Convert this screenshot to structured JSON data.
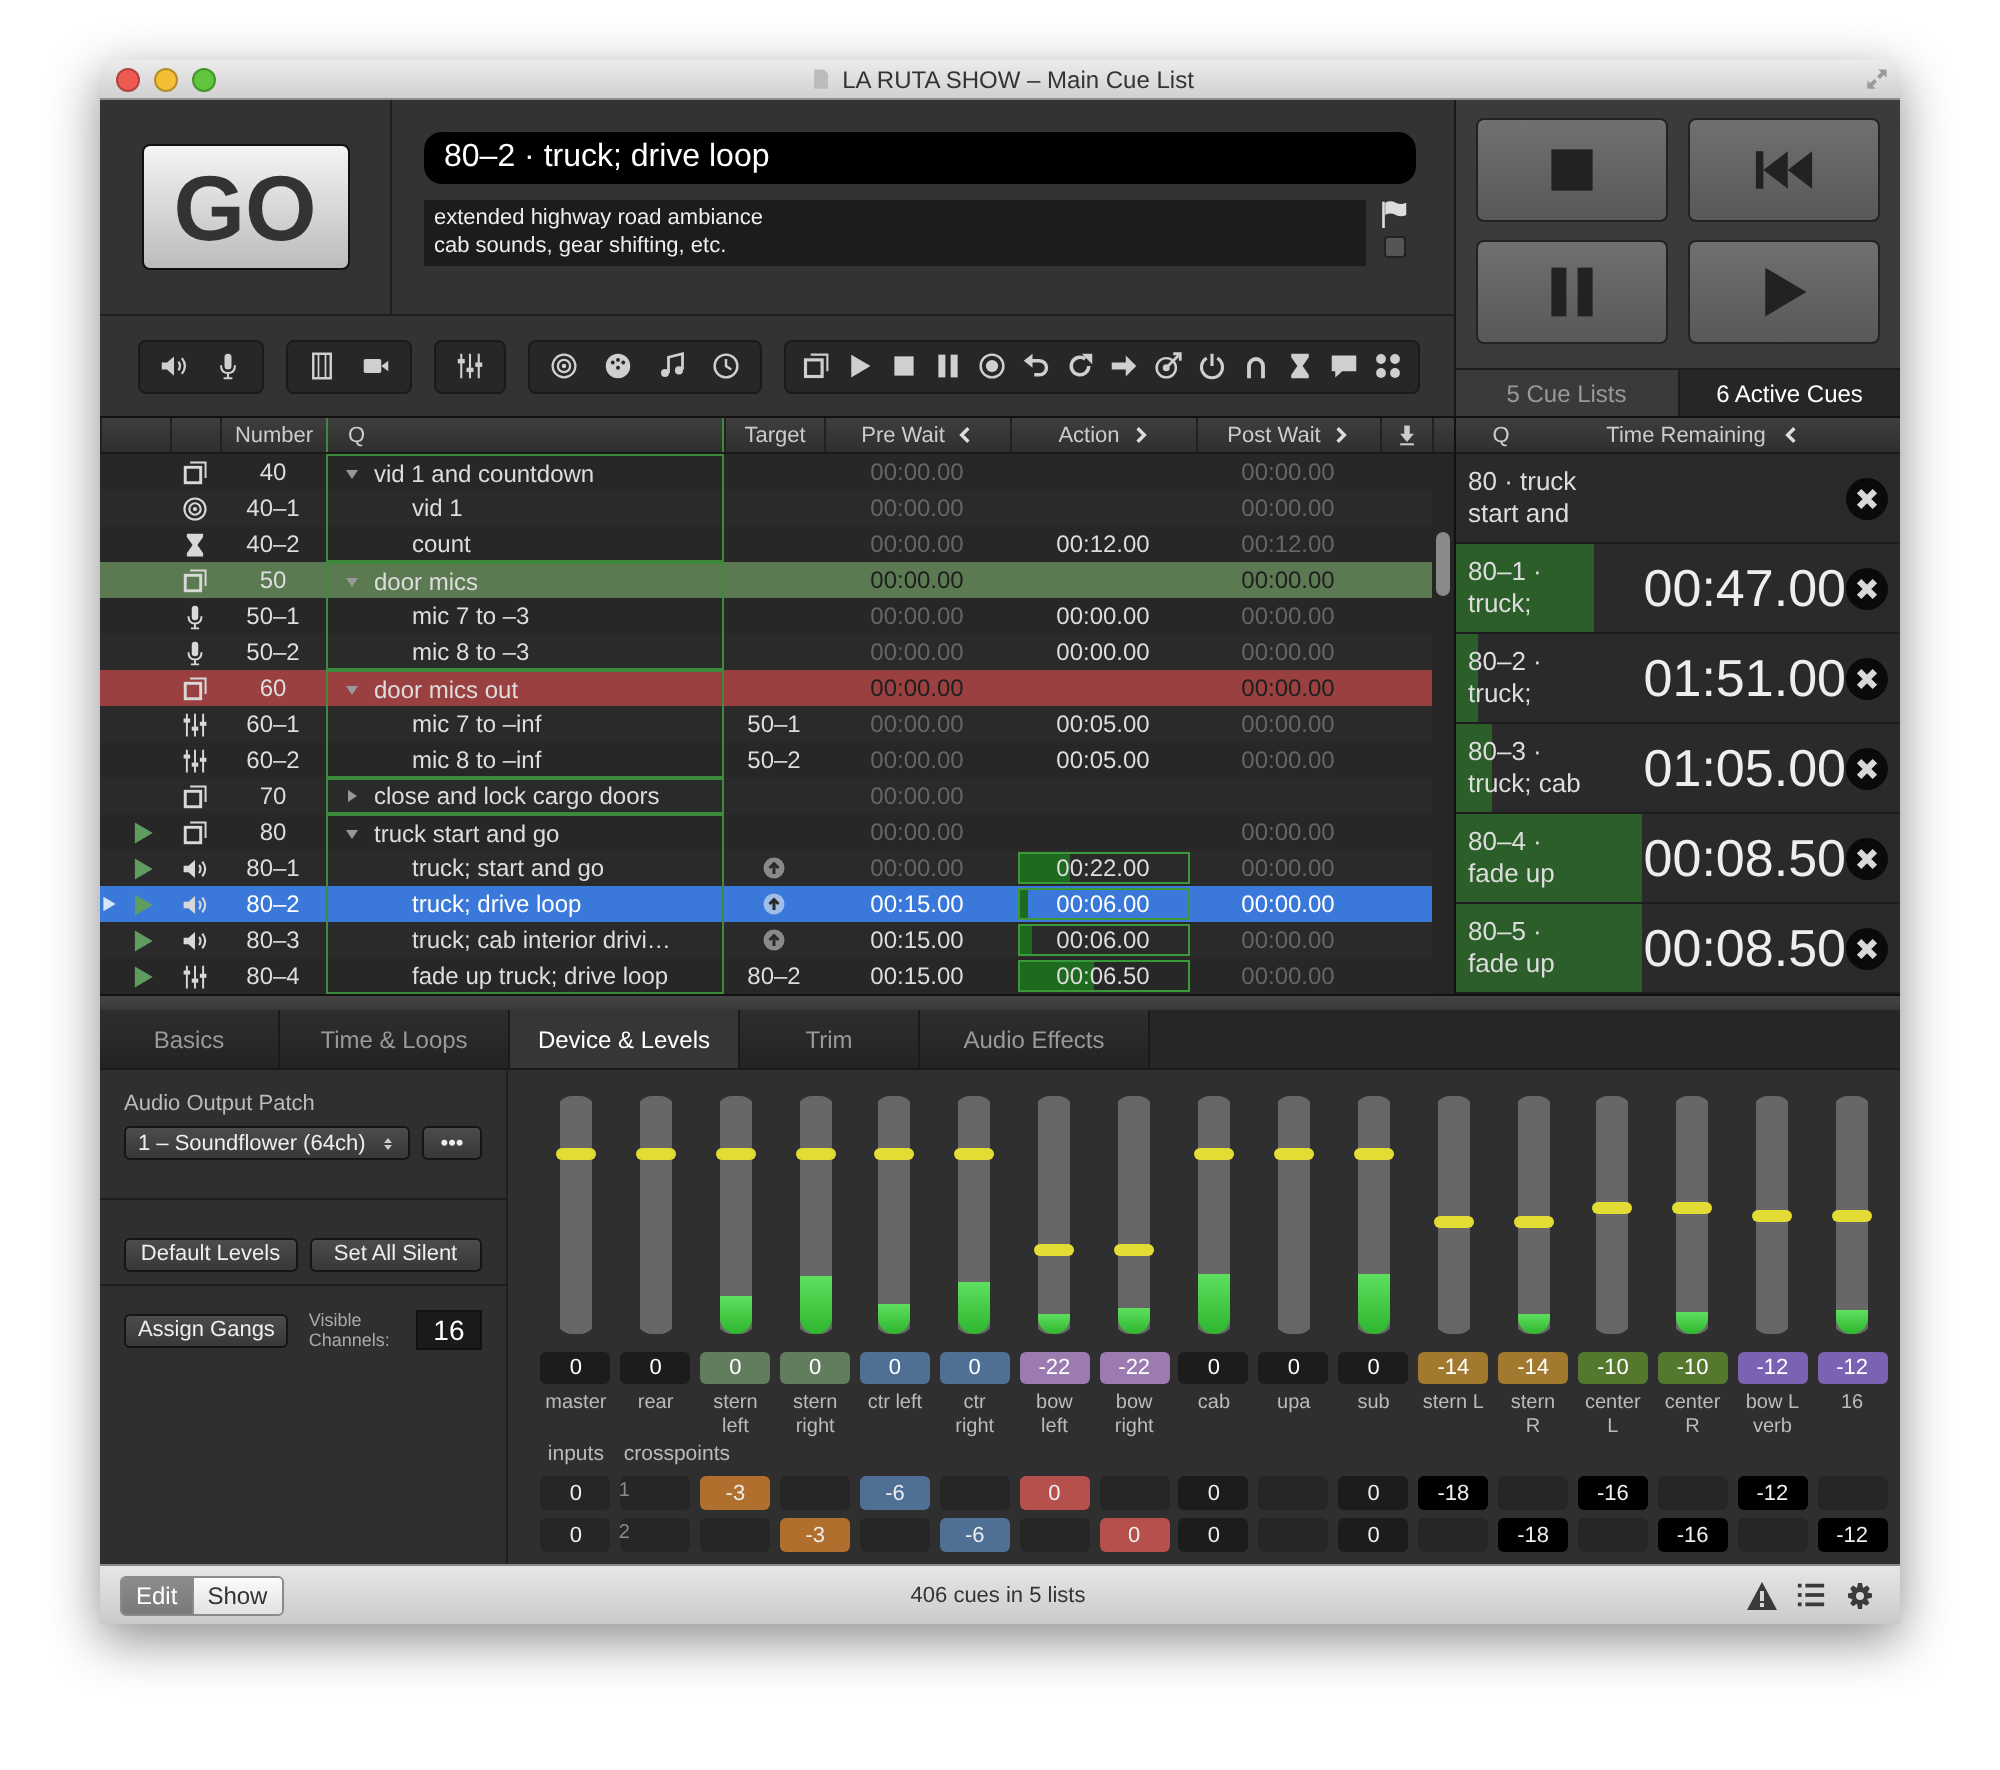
{
  "window": {
    "title": "LA RUTA SHOW – Main Cue List"
  },
  "go_button": {
    "label": "GO"
  },
  "current_cue": {
    "title": "80–2 · truck; drive loop",
    "notes": "extended highway road ambiance\ncab sounds, gear shifting, etc.",
    "flagged": false
  },
  "transport_tabs": [
    {
      "label": "5 Cue Lists",
      "selected": false
    },
    {
      "label": "6 Active Cues",
      "selected": true
    }
  ],
  "cue_table": {
    "columns": [
      "Number",
      "Q",
      "Target",
      "Pre Wait",
      "Action",
      "Post Wait"
    ],
    "rows": [
      {
        "number": "40",
        "kind": "group",
        "q": "vid 1 and countdown",
        "expanded": true,
        "running": false,
        "playhead": false,
        "selected": false,
        "pre_wait": {
          "text": "00:00.00",
          "dimmed": true
        },
        "post_wait": {
          "text": "00:00.00",
          "dimmed": true
        },
        "children": [
          {
            "number": "40–1",
            "kind": "video",
            "q": "vid 1",
            "running": false,
            "playhead": false,
            "selected": false,
            "pre_wait": {
              "text": "00:00.00",
              "dimmed": true
            },
            "post_wait": {
              "text": "00:00.00",
              "dimmed": true
            }
          },
          {
            "number": "40–2",
            "kind": "timer",
            "q": "count",
            "running": false,
            "playhead": false,
            "selected": false,
            "pre_wait": {
              "text": "00:00.00",
              "dimmed": true
            },
            "action": {
              "text": "00:12.00",
              "dimmed": false
            },
            "post_wait": {
              "text": "00:12.00",
              "dimmed": true
            }
          }
        ]
      },
      {
        "number": "50",
        "kind": "group",
        "q": "door mics",
        "expanded": true,
        "running": false,
        "playhead": false,
        "selected": false,
        "color": "#5b7a52",
        "pre_wait": {
          "text": "00:00.00",
          "dimmed": false
        },
        "post_wait": {
          "text": "00:00.00",
          "dimmed": false
        },
        "children": [
          {
            "number": "50–1",
            "kind": "mic",
            "q": "mic 7 to –3",
            "running": false,
            "playhead": false,
            "selected": false,
            "pre_wait": {
              "text": "00:00.00",
              "dimmed": true
            },
            "action": {
              "text": "00:00.00",
              "dimmed": false
            },
            "post_wait": {
              "text": "00:00.00",
              "dimmed": true
            }
          },
          {
            "number": "50–2",
            "kind": "mic",
            "q": "mic 8 to –3",
            "running": false,
            "playhead": false,
            "selected": false,
            "pre_wait": {
              "text": "00:00.00",
              "dimmed": true
            },
            "action": {
              "text": "00:00.00",
              "dimmed": false
            },
            "post_wait": {
              "text": "00:00.00",
              "dimmed": true
            }
          }
        ]
      },
      {
        "number": "60",
        "kind": "group",
        "q": "door mics out",
        "expanded": true,
        "running": false,
        "playhead": false,
        "selected": false,
        "color": "#9a4040",
        "pre_wait": {
          "text": "00:00.00",
          "dimmed": false
        },
        "post_wait": {
          "text": "00:00.00",
          "dimmed": false
        },
        "children": [
          {
            "number": "60–1",
            "kind": "fade",
            "q": "mic 7 to –inf",
            "target": "50–1",
            "running": false,
            "playhead": false,
            "selected": false,
            "pre_wait": {
              "text": "00:00.00",
              "dimmed": true
            },
            "action": {
              "text": "00:05.00",
              "dimmed": false
            },
            "post_wait": {
              "text": "00:00.00",
              "dimmed": true
            }
          },
          {
            "number": "60–2",
            "kind": "fade",
            "q": "mic 8 to –inf",
            "target": "50–2",
            "running": false,
            "playhead": false,
            "selected": false,
            "pre_wait": {
              "text": "00:00.00",
              "dimmed": true
            },
            "action": {
              "text": "00:05.00",
              "dimmed": false
            },
            "post_wait": {
              "text": "00:00.00",
              "dimmed": true
            }
          }
        ]
      },
      {
        "number": "70",
        "kind": "group",
        "q": "close and lock cargo doors",
        "expanded": false,
        "running": false,
        "playhead": false,
        "selected": false,
        "pre_wait": {
          "text": "00:00.00",
          "dimmed": true
        }
      },
      {
        "number": "80",
        "kind": "group",
        "q": "truck start and go",
        "expanded": true,
        "running": true,
        "playhead": false,
        "selected": false,
        "pre_wait": {
          "text": "00:00.00",
          "dimmed": true
        },
        "post_wait": {
          "text": "00:00.00",
          "dimmed": true
        },
        "children": [
          {
            "number": "80–1",
            "kind": "audio",
            "q": "truck; start and go",
            "target_icon": true,
            "running": true,
            "playhead": false,
            "selected": false,
            "pre_wait": {
              "text": "00:00.00",
              "dimmed": true
            },
            "action": {
              "text": "00:22.00",
              "dimmed": false,
              "level": 0.3
            },
            "post_wait": {
              "text": "00:00.00",
              "dimmed": true
            }
          },
          {
            "number": "80–2",
            "kind": "audio",
            "q": "truck; drive loop",
            "target_icon": true,
            "running": true,
            "playhead": true,
            "selected": true,
            "pre_wait": {
              "text": "00:15.00",
              "dimmed": false
            },
            "action": {
              "text": "00:06.00",
              "dimmed": false,
              "level": 0.05
            },
            "post_wait": {
              "text": "00:00.00",
              "dimmed": false
            }
          },
          {
            "number": "80–3",
            "kind": "audio",
            "q": "truck; cab interior drivi…",
            "target_icon": true,
            "running": true,
            "playhead": false,
            "selected": false,
            "pre_wait": {
              "text": "00:15.00",
              "dimmed": false
            },
            "action": {
              "text": "00:06.00",
              "dimmed": false,
              "level": 0.08
            },
            "post_wait": {
              "text": "00:00.00",
              "dimmed": true
            }
          },
          {
            "number": "80–4",
            "kind": "fade",
            "q": "fade up truck; drive loop",
            "target": "80–2",
            "running": true,
            "playhead": false,
            "selected": false,
            "pre_wait": {
              "text": "00:15.00",
              "dimmed": false
            },
            "action": {
              "text": "00:06.50",
              "dimmed": false,
              "level": 0.45
            },
            "post_wait": {
              "text": "00:00.00",
              "dimmed": true
            }
          }
        ]
      }
    ]
  },
  "active_cues": {
    "columns": [
      "Q",
      "Time Remaining"
    ],
    "cues": [
      {
        "label": "80 · truck start and"
      },
      {
        "label": "80–1 · truck;",
        "time": "00:47.00",
        "level": 0.31
      },
      {
        "label": "80–2 · truck;",
        "time": "01:51.00",
        "level": 0.05
      },
      {
        "label": "80–3 · truck; cab",
        "time": "01:05.00",
        "level": 0.08
      },
      {
        "label": "80–4 · fade up",
        "time": "00:08.50",
        "level": 0.42
      },
      {
        "label": "80–5 · fade up",
        "time": "00:08.50",
        "level": 0.42
      }
    ]
  },
  "inspector": {
    "tabs": [
      {
        "label": "Basics",
        "selected": false
      },
      {
        "label": "Time & Loops",
        "selected": false
      },
      {
        "label": "Device & Levels",
        "selected": true
      },
      {
        "label": "Trim",
        "selected": false
      },
      {
        "label": "Audio Effects",
        "selected": false
      }
    ],
    "output_patch_label": "Audio Output Patch",
    "output_patch": "1 – Soundflower (64ch)",
    "patch_edit_button": "•••",
    "level_buttons": [
      "Default Levels",
      "Set All Silent"
    ],
    "assign_gangs_button": "Assign Gangs",
    "visible_channels_label": "Visible Channels:",
    "visible_channels": "16",
    "faders": [
      {
        "name": "master",
        "value": "0",
        "color": "#1c1c1c",
        "slider": {
          "level": 0.76
        }
      },
      {
        "name": "rear",
        "value": "0",
        "color": "#1c1c1c",
        "slider": {
          "level": 0.76
        }
      },
      {
        "name": "stern left",
        "value": "0",
        "color": "#627d5e",
        "slider": {
          "level": 0.76
        },
        "meter": {
          "level": 0.16
        }
      },
      {
        "name": "stern right",
        "value": "0",
        "color": "#627d5e",
        "slider": {
          "level": 0.76
        },
        "meter": {
          "level": 0.24
        }
      },
      {
        "name": "ctr left",
        "value": "0",
        "color": "#4f6f95",
        "slider": {
          "level": 0.76
        },
        "meter": {
          "level": 0.13
        }
      },
      {
        "name": "ctr right",
        "value": "0",
        "color": "#4f6f95",
        "slider": {
          "level": 0.76
        },
        "meter": {
          "level": 0.22
        }
      },
      {
        "name": "bow left",
        "value": "-22",
        "color": "#9b7bb0",
        "slider": {
          "level": 0.35
        },
        "meter": {
          "level": 0.08
        }
      },
      {
        "name": "bow right",
        "value": "-22",
        "color": "#9b7bb0",
        "slider": {
          "level": 0.35
        },
        "meter": {
          "level": 0.11
        }
      },
      {
        "name": "cab",
        "value": "0",
        "color": "#1c1c1c",
        "slider": {
          "level": 0.76
        },
        "meter": {
          "level": 0.25
        }
      },
      {
        "name": "upa",
        "value": "0",
        "color": "#1c1c1c",
        "slider": {
          "level": 0.76
        }
      },
      {
        "name": "sub",
        "value": "0",
        "color": "#1c1c1c",
        "slider": {
          "level": 0.76
        },
        "meter": {
          "level": 0.25
        }
      },
      {
        "name": "stern L",
        "value": "-14",
        "color": "#a17a2f",
        "slider": {
          "level": 0.47
        }
      },
      {
        "name": "stern R",
        "value": "-14",
        "color": "#a17a2f",
        "slider": {
          "level": 0.47
        },
        "meter": {
          "level": 0.08
        }
      },
      {
        "name": "center L",
        "value": "-10",
        "color": "#55782f",
        "slider": {
          "level": 0.53
        }
      },
      {
        "name": "center R",
        "value": "-10",
        "color": "#55782f",
        "slider": {
          "level": 0.53
        },
        "meter": {
          "level": 0.09
        }
      },
      {
        "name": "bow L verb",
        "value": "-12",
        "color": "#7c62b3",
        "slider": {
          "level": 0.5
        }
      },
      {
        "name": "16",
        "value": "-12",
        "color": "#7c62b3",
        "slider": {
          "level": 0.5
        },
        "meter": {
          "level": 0.1
        }
      }
    ],
    "inputs_label": "inputs",
    "crosspoints_label": "crosspoints",
    "crosspoint_rows": [
      {
        "input": "0",
        "number": "1",
        "cells": [
          {},
          {
            "text": "-3",
            "color": "#b06f2c"
          },
          {},
          {
            "text": "-6",
            "color": "#4f6f95"
          },
          {},
          {
            "text": "0",
            "color": "#b5504c"
          },
          {},
          {
            "text": "0",
            "color": "#1c1c1c"
          },
          {},
          {
            "text": "0",
            "color": "#1c1c1c"
          },
          {
            "text": "-18",
            "color": "#000000"
          },
          {},
          {
            "text": "-16",
            "color": "#000000"
          },
          {},
          {
            "text": "-12",
            "color": "#000000"
          },
          {}
        ]
      },
      {
        "input": "0",
        "number": "2",
        "cells": [
          {},
          {},
          {
            "text": "-3",
            "color": "#b06f2c"
          },
          {},
          {
            "text": "-6",
            "color": "#4f6f95"
          },
          {},
          {
            "text": "0",
            "color": "#b5504c"
          },
          {
            "text": "0",
            "color": "#1c1c1c"
          },
          {},
          {
            "text": "0",
            "color": "#1c1c1c"
          },
          {},
          {
            "text": "-18",
            "color": "#000000"
          },
          {},
          {
            "text": "-16",
            "color": "#000000"
          },
          {},
          {
            "text": "-12",
            "color": "#000000"
          }
        ]
      }
    ]
  },
  "status_bar": {
    "modes": [
      {
        "label": "Edit",
        "selected": true
      },
      {
        "label": "Show",
        "selected": false
      }
    ],
    "summary": "406 cues in 5 lists"
  }
}
